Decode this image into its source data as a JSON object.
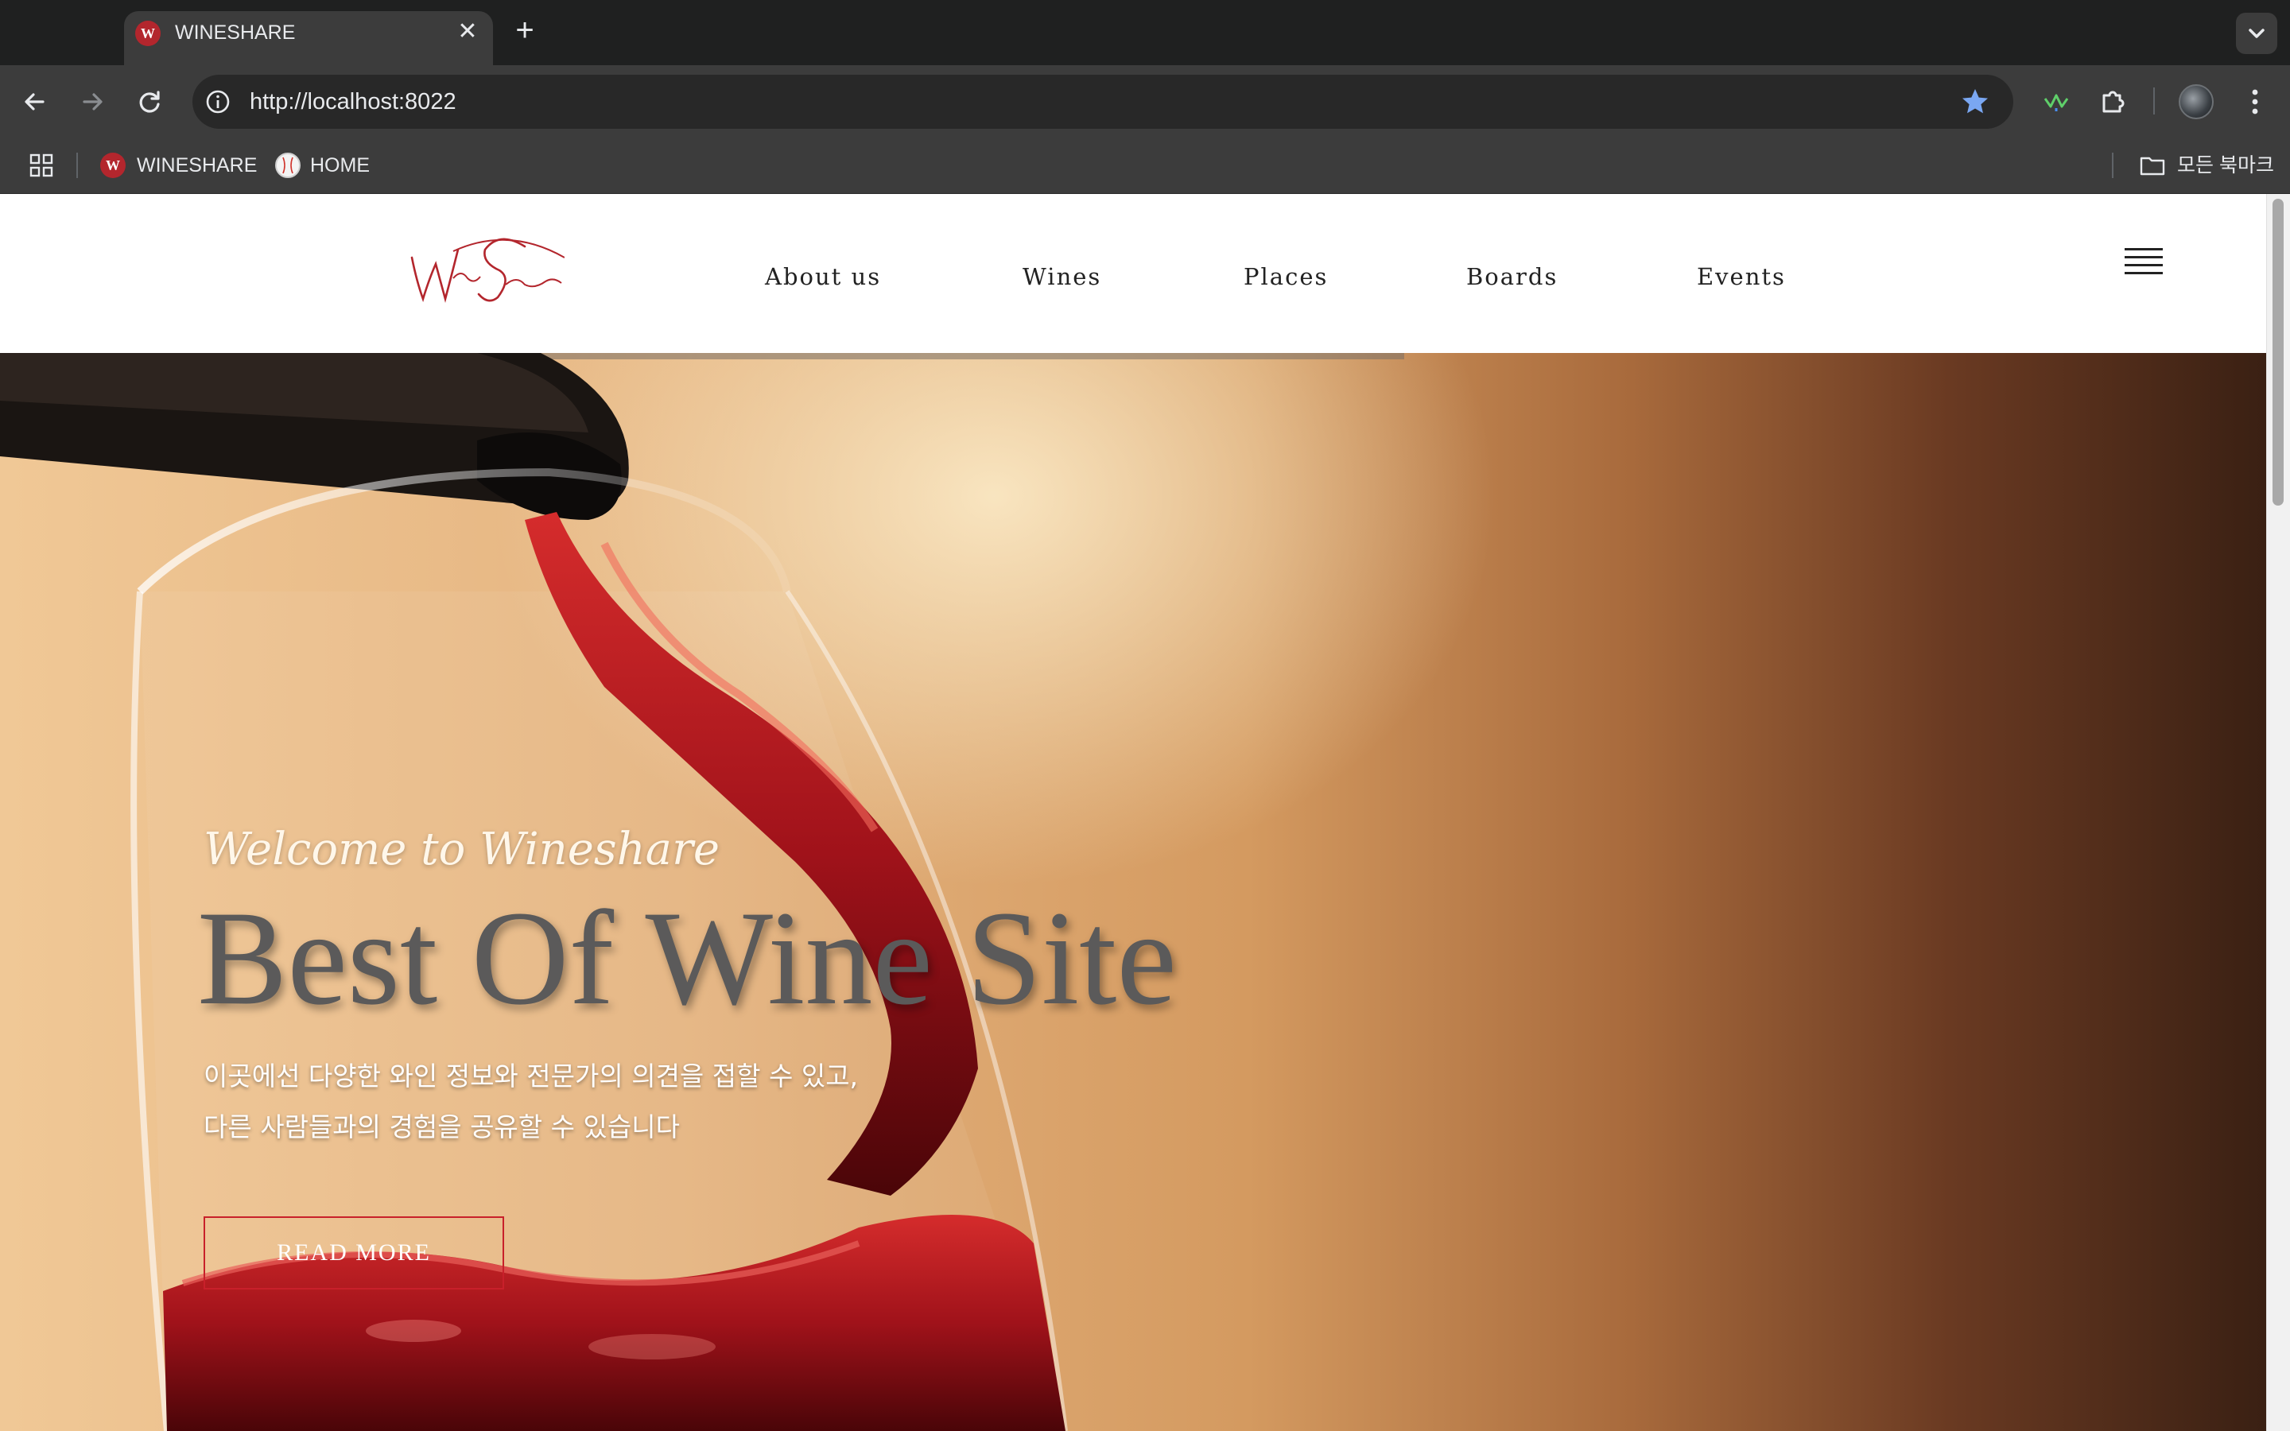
{
  "browser": {
    "tab_title": "WINESHARE",
    "tab_favicon_letter": "W",
    "tab_close": "✕",
    "new_tab": "+",
    "url": "http://localhost:8022",
    "bookmarks": [
      {
        "label": "WINESHARE"
      },
      {
        "label": "HOME"
      }
    ],
    "all_bookmarks": "모든 북마크"
  },
  "site": {
    "logo_text": "Wine Share",
    "nav": [
      "About us",
      "Wines",
      "Places",
      "Boards",
      "Events"
    ],
    "accent_color": "#c8202a"
  },
  "hero": {
    "welcome": "Welcome to Wineshare",
    "headline": "Best Of Wine Site",
    "desc_line1": "이곳에선 다양한 와인 정보와 전문가의 의견을 접할 수 있고,",
    "desc_line2": "다른 사람들과의 경험을 공유할 수 있습니다",
    "cta": "READ MORE"
  }
}
